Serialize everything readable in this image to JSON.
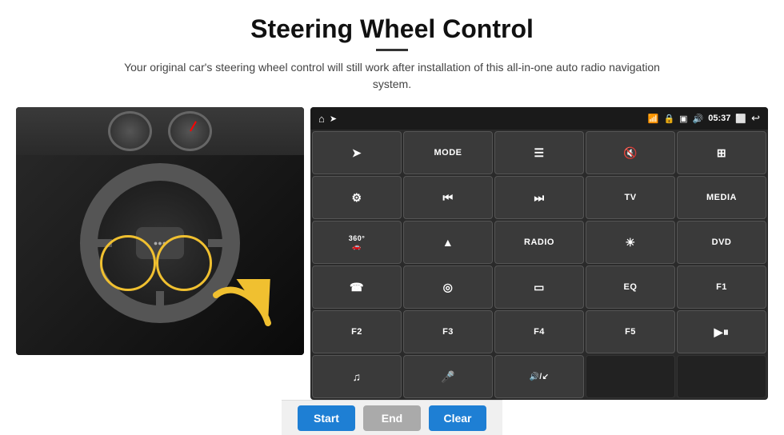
{
  "page": {
    "title": "Steering Wheel Control",
    "divider": true,
    "subtitle": "Your original car's steering wheel control will still work after installation of this all-in-one auto radio navigation system."
  },
  "status_bar": {
    "home_icon": "⌂",
    "wifi_icon": "📶",
    "lock_icon": "🔒",
    "card_icon": "💳",
    "bluetooth_icon": "🔊",
    "time": "05:37",
    "window_icon": "⬜",
    "back_icon": "↩"
  },
  "buttons": [
    {
      "id": "row1",
      "cells": [
        {
          "label": "↗",
          "type": "icon"
        },
        {
          "label": "MODE",
          "type": "text"
        },
        {
          "label": "☰",
          "type": "icon"
        },
        {
          "label": "🔇",
          "type": "icon"
        },
        {
          "label": "⊞",
          "type": "icon"
        }
      ]
    },
    {
      "id": "row2",
      "cells": [
        {
          "label": "⚙",
          "type": "icon"
        },
        {
          "label": "⏮",
          "type": "icon"
        },
        {
          "label": "⏭",
          "type": "icon"
        },
        {
          "label": "TV",
          "type": "text"
        },
        {
          "label": "MEDIA",
          "type": "text"
        }
      ]
    },
    {
      "id": "row3",
      "cells": [
        {
          "label": "360°",
          "type": "text-small"
        },
        {
          "label": "▲",
          "type": "icon"
        },
        {
          "label": "RADIO",
          "type": "text"
        },
        {
          "label": "☀",
          "type": "icon"
        },
        {
          "label": "DVD",
          "type": "text"
        }
      ]
    },
    {
      "id": "row4",
      "cells": [
        {
          "label": "☎",
          "type": "icon"
        },
        {
          "label": "◎",
          "type": "icon"
        },
        {
          "label": "▭",
          "type": "icon"
        },
        {
          "label": "EQ",
          "type": "text"
        },
        {
          "label": "F1",
          "type": "text"
        }
      ]
    },
    {
      "id": "row5",
      "cells": [
        {
          "label": "F2",
          "type": "text"
        },
        {
          "label": "F3",
          "type": "text"
        },
        {
          "label": "F4",
          "type": "text"
        },
        {
          "label": "F5",
          "type": "text"
        },
        {
          "label": "▶⏸",
          "type": "icon"
        }
      ]
    },
    {
      "id": "row6",
      "cells": [
        {
          "label": "♫",
          "type": "icon"
        },
        {
          "label": "🎤",
          "type": "icon"
        },
        {
          "label": "🔊↙",
          "type": "icon"
        },
        {
          "label": "",
          "type": "empty"
        },
        {
          "label": "",
          "type": "empty"
        }
      ]
    }
  ],
  "bottom_bar": {
    "start_label": "Start",
    "end_label": "End",
    "clear_label": "Clear"
  }
}
